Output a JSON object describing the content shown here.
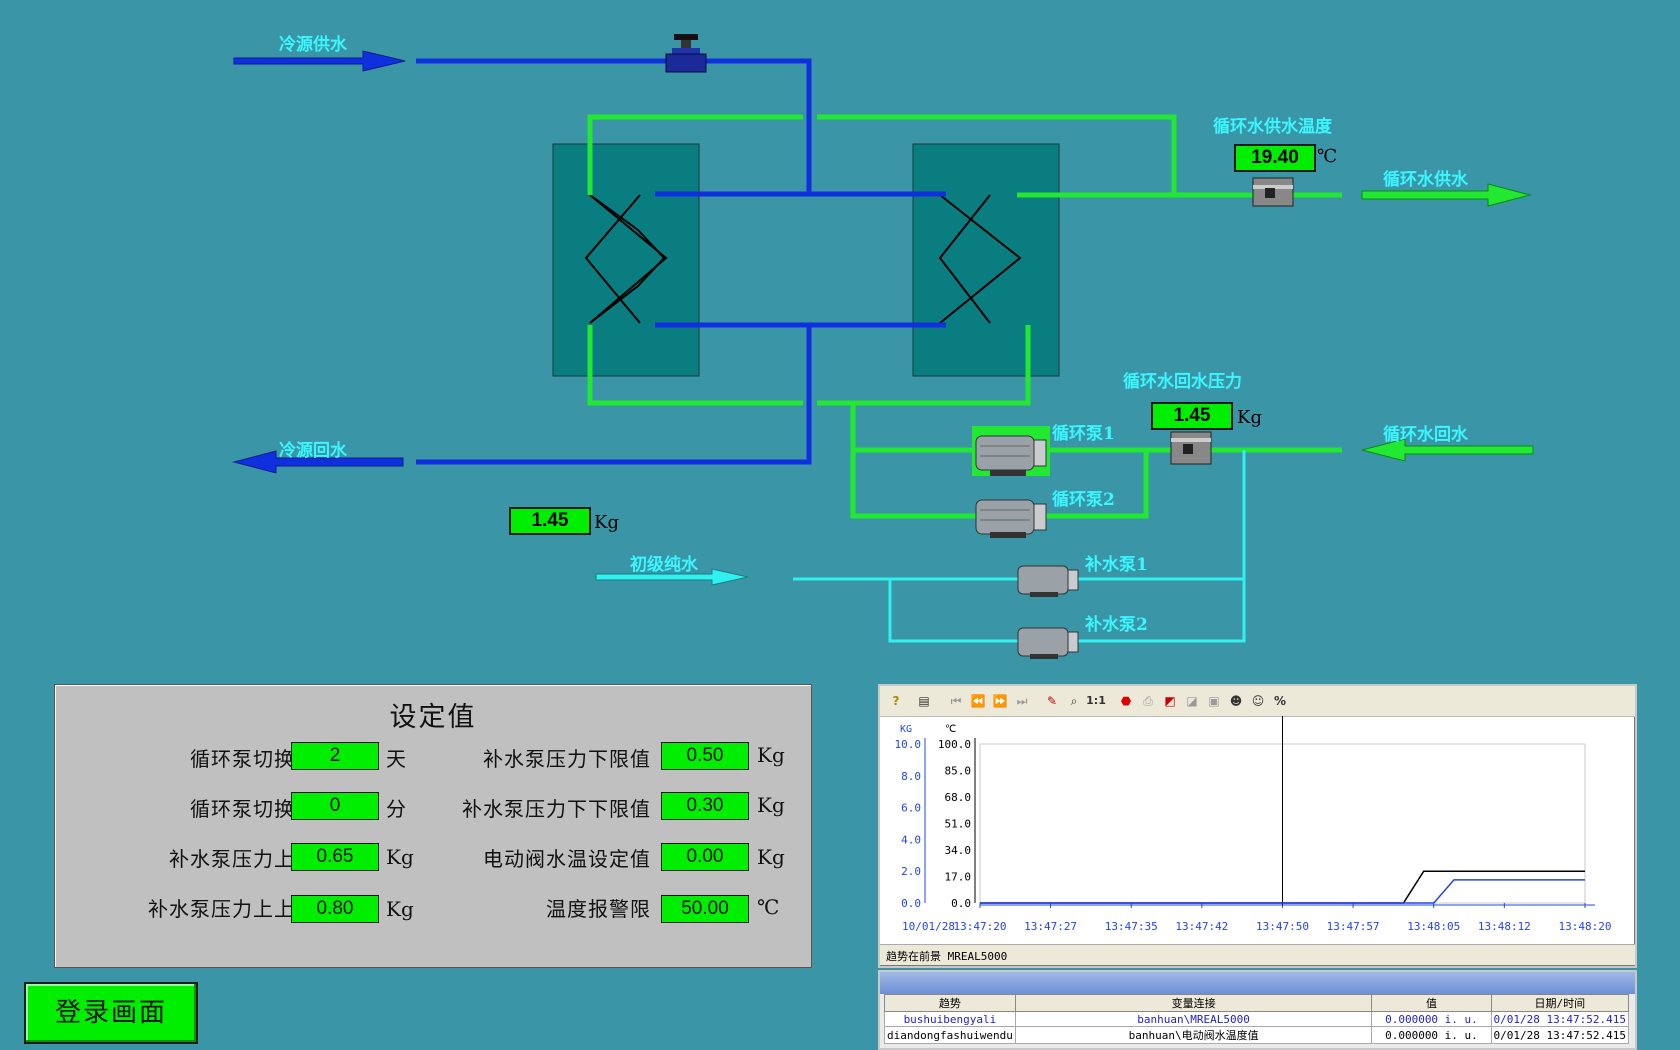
{
  "labels": {
    "cold_supply": "冷源供水",
    "cold_return": "冷源回水",
    "circ_supply_temp": "循环水供水温度",
    "circ_supply": "循环水供水",
    "circ_return_pressure": "循环水回水压力",
    "circ_return": "循环水回水",
    "pump1": "循环泵1",
    "pump2": "循环泵2",
    "primary_water": "初级纯水",
    "makeup1": "补水泵1",
    "makeup2": "补水泵2"
  },
  "readings": {
    "supply_temp": "19.40",
    "supply_temp_unit": "℃",
    "return_pressure": "1.45",
    "return_pressure_unit": "Kg",
    "makeup_pressure": "1.45",
    "makeup_pressure_unit": "Kg"
  },
  "settings": {
    "title": "设定值",
    "rows": [
      {
        "label": "循环泵切换时间",
        "value": "2",
        "unit": "天"
      },
      {
        "label": "循环泵切换时间",
        "value": "0",
        "unit": "分"
      },
      {
        "label": "补水泵压力上限值",
        "value": "0.65",
        "unit": "Kg"
      },
      {
        "label": "补水泵压力上上限值",
        "value": "0.80",
        "unit": "Kg"
      },
      {
        "label": "补水泵压力下限值",
        "value": "0.50",
        "unit": "Kg"
      },
      {
        "label": "补水泵压力下下限值",
        "value": "0.30",
        "unit": "Kg"
      },
      {
        "label": "电动阀水温设定值",
        "value": "0.00",
        "unit": "Kg"
      },
      {
        "label": "温度报警限",
        "value": "50.00",
        "unit": "℃"
      }
    ]
  },
  "login_button": "登录画面",
  "trend": {
    "toolbar_icons": [
      "help-icon",
      "properties-icon",
      "first-icon",
      "rewind-icon",
      "forward-icon",
      "last-icon",
      "pen-icon",
      "zoom-icon",
      "1:1",
      "stop-icon",
      "print-icon",
      "chart-icon",
      "export-icon",
      "save-icon",
      "user-icon",
      "user2-icon",
      "%"
    ],
    "zoom_label": "1:1",
    "percent_label": "%",
    "status": "趋势在前景 MREAL5000",
    "table_headers": [
      "趋势",
      "变量连接",
      "值",
      "日期/时间"
    ],
    "table_rows": [
      [
        "bushuibengyali",
        "banhuan\\MREAL5000",
        "0.000000 i. u.",
        "0/01/28 13:47:52.415"
      ],
      [
        "diandongfashuiwendu",
        "banhuan\\电动阀水温度值",
        "0.000000 i. u.",
        "0/01/28 13:47:52.415"
      ]
    ]
  },
  "chart_data": {
    "type": "line",
    "left_axis": {
      "unit": "KG",
      "ticks": [
        "10.0",
        "8.0",
        "6.0",
        "4.0",
        "2.0",
        "0.0"
      ],
      "range": [
        0,
        10
      ]
    },
    "right_axis": {
      "unit": "℃",
      "ticks": [
        "100.0",
        "85.0",
        "68.0",
        "51.0",
        "34.0",
        "17.0",
        "0.0"
      ],
      "range": [
        0,
        100
      ]
    },
    "x_ticks": [
      "13:47:20",
      "13:47:27",
      "13:47:35",
      "13:47:42",
      "13:47:50",
      "13:47:57",
      "13:48:05",
      "13:48:12",
      "13:48:20"
    ],
    "date_label": "10/01/28",
    "cursor_time": "13:47:50",
    "series": [
      {
        "color": "#000000",
        "points": [
          [
            "13:47:20",
            0
          ],
          [
            "13:48:02",
            0
          ],
          [
            "13:48:04",
            2.0
          ],
          [
            "13:48:20",
            2.0
          ]
        ]
      },
      {
        "color": "#2244ee",
        "points": [
          [
            "13:47:20",
            0
          ],
          [
            "13:48:05",
            0
          ],
          [
            "13:48:07",
            1.45
          ],
          [
            "13:48:20",
            1.45
          ]
        ]
      }
    ]
  },
  "colors": {
    "background": "#3a96a6",
    "cold_pipe": "#1030e0",
    "circ_pipe": "#22e832",
    "makeup_pipe": "#30f0f0",
    "display_green": "#00ee00"
  }
}
